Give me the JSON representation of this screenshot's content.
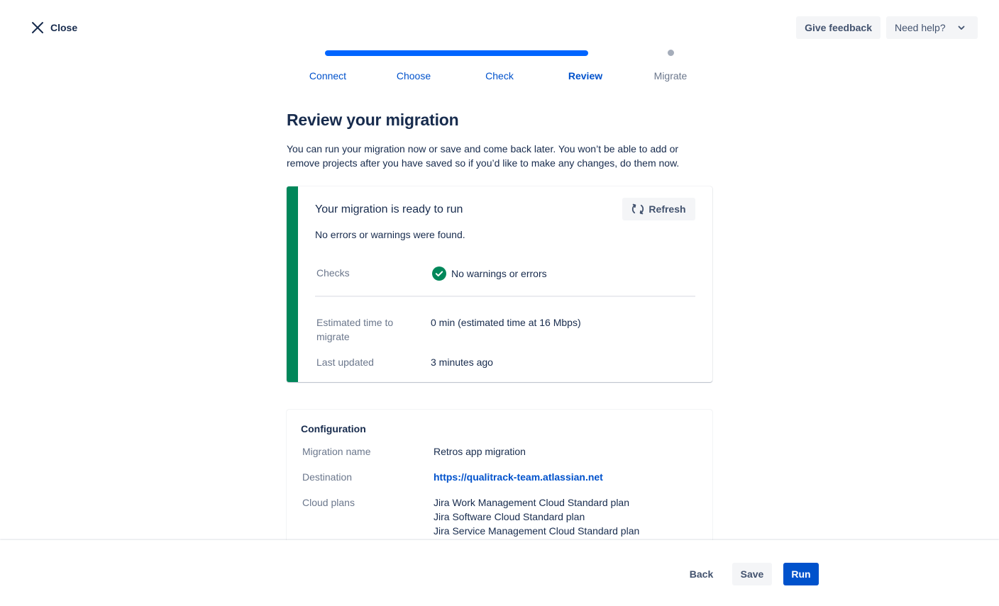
{
  "header": {
    "close_label": "Close",
    "feedback_label": "Give feedback",
    "help_label": "Need help?"
  },
  "steps": [
    {
      "label": "Connect",
      "state": "complete"
    },
    {
      "label": "Choose",
      "state": "complete"
    },
    {
      "label": "Check",
      "state": "complete"
    },
    {
      "label": "Review",
      "state": "current"
    },
    {
      "label": "Migrate",
      "state": "pending"
    }
  ],
  "page": {
    "title": "Review your migration",
    "description": "You can run your migration now or save and come back later. You won’t be able to add or remove projects after you have saved so if you’d like to make any changes, do them now."
  },
  "status_card": {
    "title": "Your migration is ready to run",
    "refresh_label": "Refresh",
    "subtitle": "No errors or warnings were found.",
    "checks_label": "Checks",
    "checks_value": "No warnings or errors",
    "time_label": "Estimated time to migrate",
    "time_value": "0 min (estimated time at 16 Mbps)",
    "updated_label": "Last updated",
    "updated_value": "3 minutes ago",
    "accent_color": "#00875A"
  },
  "config": {
    "title": "Configuration",
    "name_label": "Migration name",
    "name_value": "Retros app migration",
    "destination_label": "Destination",
    "destination_value": "https://qualitrack-team.atlassian.net",
    "plans_label": "Cloud plans",
    "plans": [
      "Jira Work Management Cloud Standard plan",
      "Jira Software Cloud Standard plan",
      "Jira Service Management Cloud Standard plan"
    ]
  },
  "footer": {
    "back_label": "Back",
    "save_label": "Save",
    "run_label": "Run"
  },
  "colors": {
    "primary": "#0052CC",
    "progress": "#0065FF",
    "success": "#00875A",
    "text": "#172B4D",
    "subtle_text": "#6B778C"
  }
}
